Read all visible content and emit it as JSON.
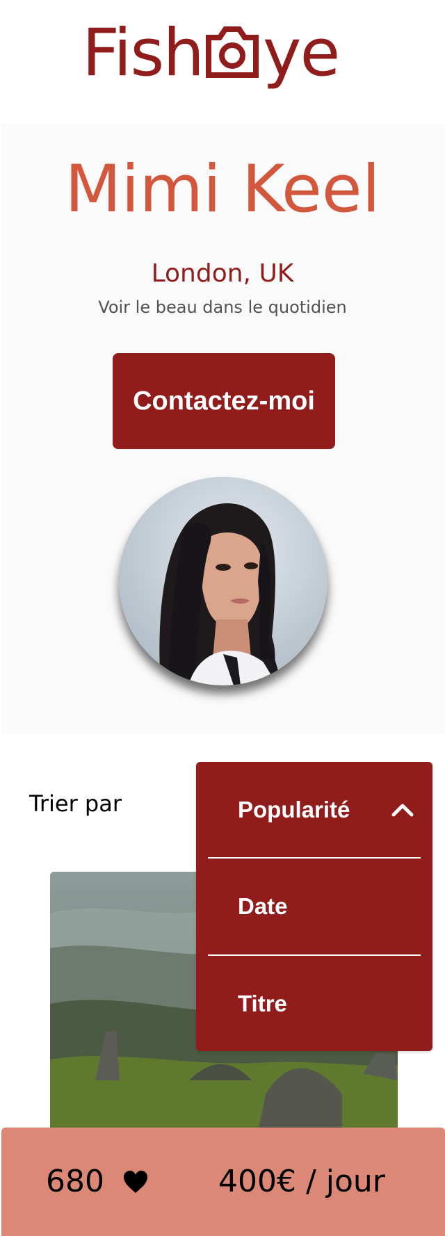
{
  "header": {
    "logo_left": "Fish",
    "logo_right": "ye",
    "logo_icon": "camera-icon"
  },
  "photographer": {
    "name": "Mimi Keel",
    "location": "London, UK",
    "tagline": "Voir le beau dans le quotidien",
    "contact_label": "Contactez-moi",
    "portrait_icon": "portrait-photo"
  },
  "sort": {
    "label": "Trier par",
    "options": [
      {
        "label": "Popularité",
        "selected": true
      },
      {
        "label": "Date",
        "selected": false
      },
      {
        "label": "Titre",
        "selected": false
      }
    ],
    "chevron_icon": "chevron-up-icon"
  },
  "stats": {
    "likes": "680",
    "heart_icon": "heart-icon",
    "price": "400€ / jour"
  },
  "colors": {
    "brand": "#901c1c",
    "accent": "#d3573c",
    "stats_bg": "#db8876",
    "banner_bg": "#fafafa"
  }
}
